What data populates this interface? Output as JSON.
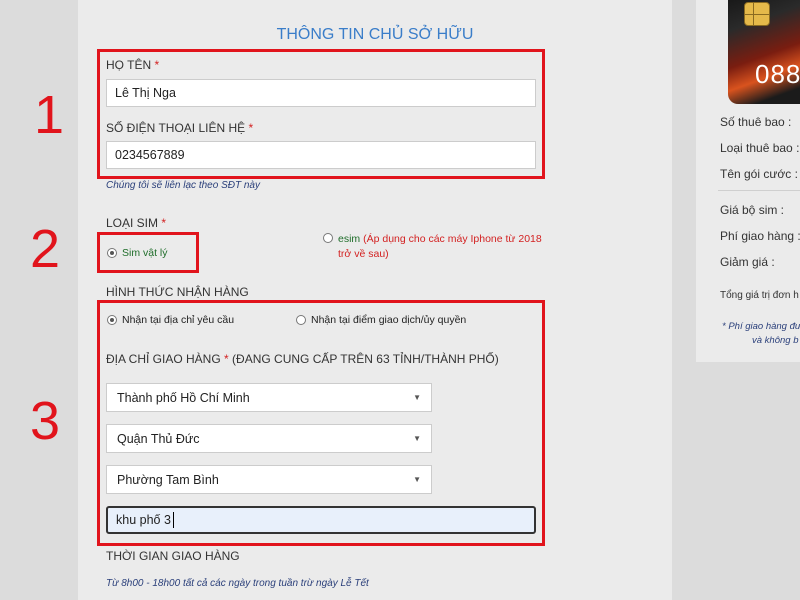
{
  "form": {
    "section_title": "THÔNG TIN CHỦ SỞ HỮU",
    "name_label": "HỌ TÊN",
    "name_value": "Lê Thị Nga",
    "phone_label": "SỐ ĐIỆN THOẠI LIÊN HỆ",
    "phone_value": "0234567889",
    "phone_note": "Chúng tôi sẽ liên lạc theo SĐT này",
    "required_mark": "*",
    "sim_type_label": "LOẠI SIM",
    "sim_options": [
      {
        "label": "Sim vật lý",
        "selected": true
      },
      {
        "label": "esim",
        "note": "(Áp dụng cho các máy Iphone từ 2018 trở về sau)",
        "selected": false
      }
    ],
    "delivery_method_label": "HÌNH THỨC NHẬN HÀNG",
    "delivery_options": [
      {
        "label": "Nhận tại địa chỉ yêu cầu",
        "selected": true
      },
      {
        "label": "Nhận tại điểm giao dịch/ủy quyền",
        "selected": false
      }
    ],
    "address_label": "ĐỊA CHỈ GIAO HÀNG",
    "address_label_suffix": "(ĐANG CUNG CẤP TRÊN 63 TỈNH/THÀNH PHỐ)",
    "city_value": "Thành phố Hồ Chí Minh",
    "district_value": "Quận Thủ Đức",
    "ward_value": "Phường Tam Bình",
    "street_value": "khu phố 3",
    "delivery_time_label": "THỜI GIAN GIAO HÀNG",
    "delivery_time_note": "Từ 8h00 - 18h00 tất cả các ngày trong tuần trừ ngày Lễ Tết"
  },
  "annotations": {
    "step1": "1",
    "step2": "2",
    "step3": "3",
    "box_color": "#e1141c"
  },
  "summary": {
    "sim_number_partial": "088",
    "subscriber_number_label": "Số thuê bao :",
    "subscriber_type_label": "Loại thuê bao :",
    "plan_name_label": "Tên gói cước :",
    "sim_kit_price_label": "Giá bộ sim :",
    "shipping_fee_label": "Phí giao hàng :",
    "discount_label": "Giảm giá :",
    "order_total_label": "Tổng giá trị đơn h",
    "note_line1": "* Phí giao hàng đư",
    "note_line2": "và không b"
  },
  "colors": {
    "accent_blue": "#3a7dc9",
    "required_red": "#d32222",
    "note_navy": "#2a3f7a",
    "sim_option_green": "#1f6d2a"
  }
}
